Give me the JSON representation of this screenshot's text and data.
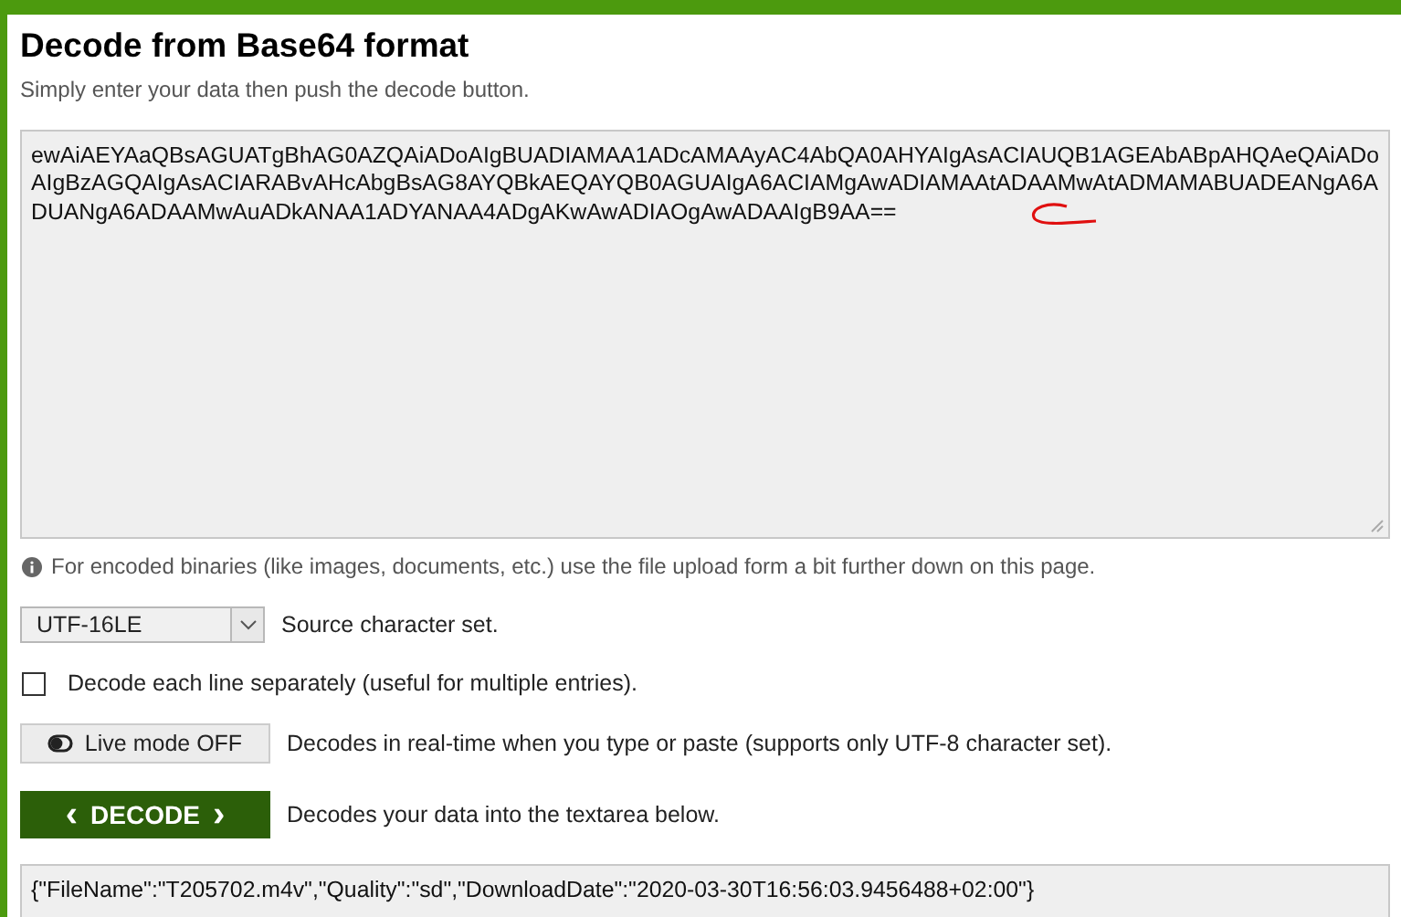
{
  "header": {
    "title": "Decode from Base64 format",
    "subtitle": "Simply enter your data then push the decode button."
  },
  "input": {
    "value": "ewAiAEYAaQBsAGUATgBhAG0AZQAiADoAIgBUADIAMAA1ADcAMAAyAC4AbQA0AHYAIgAsACIAUQB1AGEAbABpAHQAeQAiADoAIgBzAGQAIgAsACIARABvAHcAbgBsAG8AYQBkAEQAYQB0AGUAIgA6ACIAMgAwADIAMAAtADAAMwAtADMAMABUADEANgA6ADUANgA6ADAAMwAuADkANAA1ADYANAA4ADgAKwAwADIAOgAwADAAIgB9AA=="
  },
  "info": "For encoded binaries (like images, documents, etc.) use the file upload form a bit further down on this page.",
  "charset": {
    "value": "UTF-16LE",
    "label": "Source character set."
  },
  "separate_lines": {
    "checked": false,
    "label": "Decode each line separately (useful for multiple entries)."
  },
  "live_mode": {
    "on": false,
    "button": "Live mode OFF",
    "label": "Decodes in real-time when you type or paste (supports only UTF-8 character set)."
  },
  "decode": {
    "button": "DECODE",
    "left": "‹",
    "right": "›",
    "label": "Decodes your data into the textarea below."
  },
  "output": {
    "value": "{\"FileName\":\"T205702.m4v\",\"Quality\":\"sd\",\"DownloadDate\":\"2020-03-30T16:56:03.9456488+02:00\"}"
  }
}
